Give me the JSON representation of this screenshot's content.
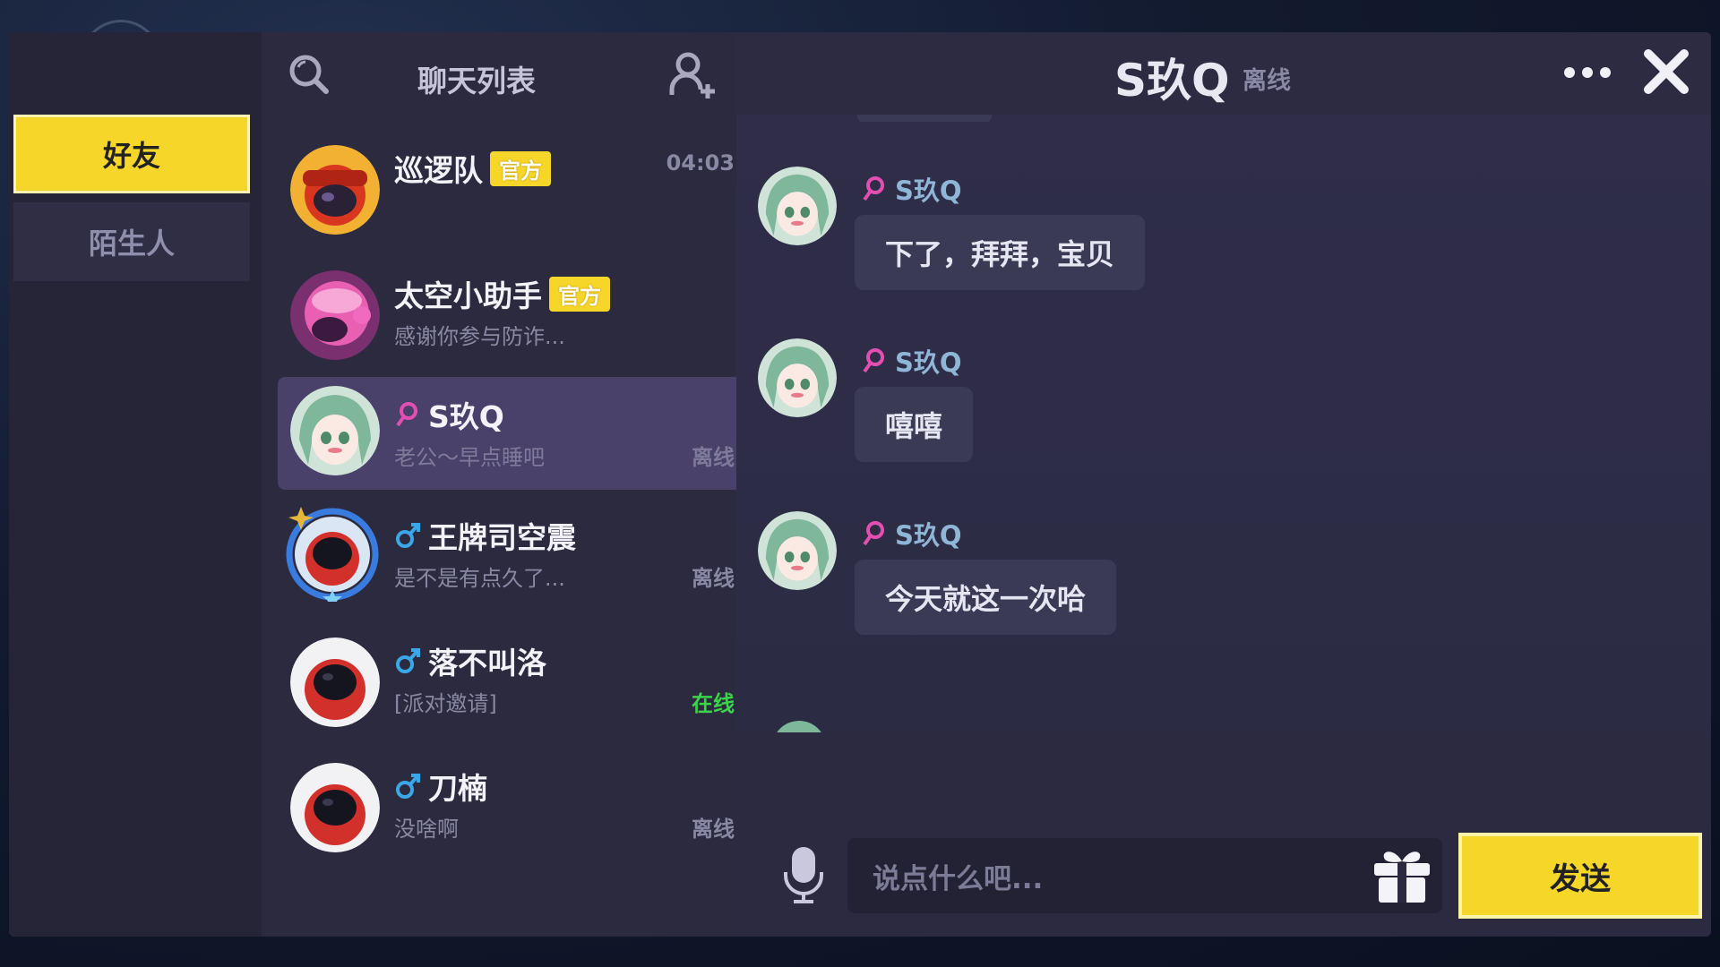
{
  "categories": {
    "friends": "好友",
    "strangers": "陌生人"
  },
  "chat_list": {
    "title": "聊天列表",
    "items": [
      {
        "name": "巡逻队",
        "badge": "官方",
        "preview": "",
        "time": "04:03",
        "status": ""
      },
      {
        "name": "太空小助手",
        "badge": "官方",
        "preview": "感谢你参与防诈...",
        "time": "",
        "status": ""
      },
      {
        "name": "S玖Q",
        "gender": "female",
        "preview": "老公～早点睡吧",
        "status": "离线"
      },
      {
        "name": "王牌司空震",
        "gender": "male",
        "preview": "是不是有点久了...",
        "status": "离线"
      },
      {
        "name": "落不叫洛",
        "gender": "male",
        "preview": "[派对邀请]",
        "status": "在线"
      },
      {
        "name": "刀楠",
        "gender": "male",
        "preview": "没啥啊",
        "status": "离线"
      }
    ]
  },
  "conversation": {
    "title": "S玖Q",
    "status": "离线",
    "messages": [
      {
        "sender": "S玖Q",
        "text": "下了，拜拜，宝贝"
      },
      {
        "sender": "S玖Q",
        "text": "嘻嘻"
      },
      {
        "sender": "S玖Q",
        "text": "今天就这一次哈"
      }
    ]
  },
  "composer": {
    "placeholder": "说点什么吧...",
    "send_label": "发送"
  },
  "colors": {
    "accent": "#f7d62a",
    "online": "#3cd24a",
    "female": "#e24fb0",
    "male": "#3aa8e8"
  }
}
